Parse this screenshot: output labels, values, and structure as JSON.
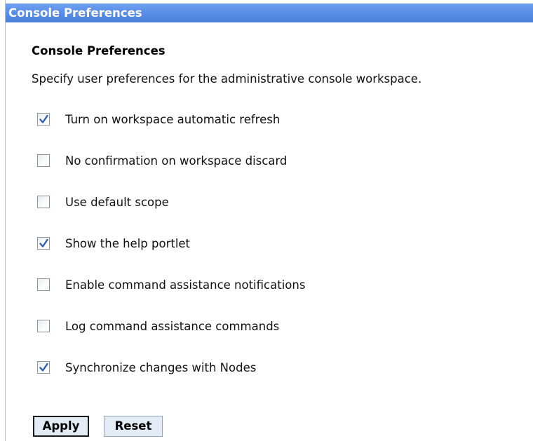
{
  "window": {
    "title": "Console Preferences"
  },
  "section": {
    "heading": "Console Preferences",
    "description": "Specify user preferences for the administrative console workspace."
  },
  "preferences": [
    {
      "label": "Turn on workspace automatic refresh",
      "checked": true
    },
    {
      "label": "No confirmation on workspace discard",
      "checked": false
    },
    {
      "label": "Use default scope",
      "checked": false
    },
    {
      "label": "Show the help portlet",
      "checked": true
    },
    {
      "label": "Enable command assistance notifications",
      "checked": false
    },
    {
      "label": "Log command assistance commands",
      "checked": false
    },
    {
      "label": "Synchronize changes with Nodes",
      "checked": true
    }
  ],
  "buttons": {
    "apply_label": "Apply",
    "reset_label": "Reset"
  },
  "colors": {
    "title_bar": "#5b8fe6",
    "checkmark": "#2f5fb3"
  },
  "icons": {
    "checkbox_checked": "checkmark-icon"
  }
}
